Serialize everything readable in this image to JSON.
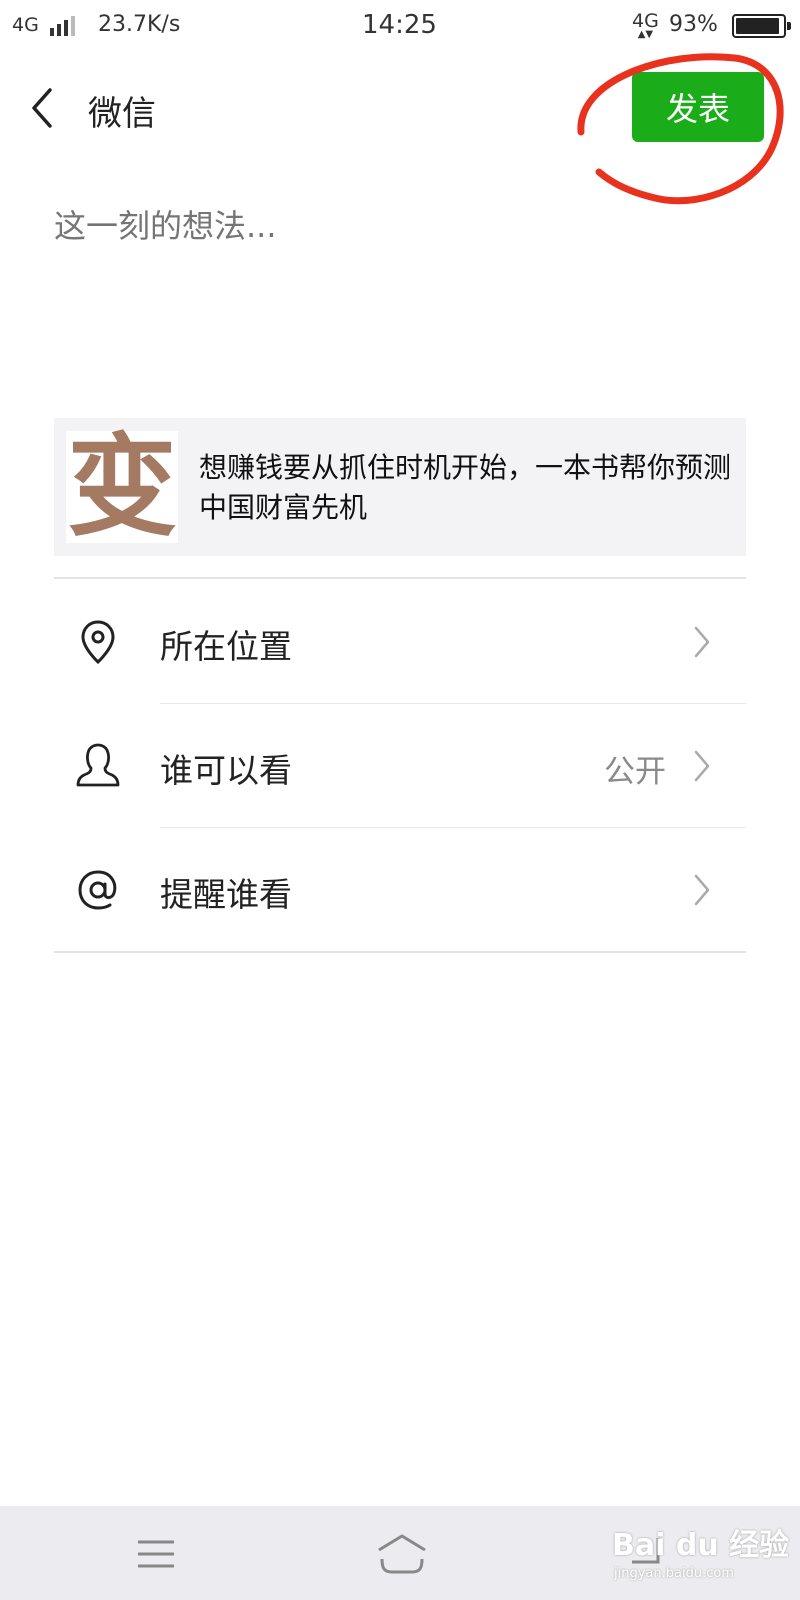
{
  "status_bar": {
    "network_left": "4G",
    "speed": "23.7K/s",
    "time": "14:25",
    "network_right": "4G",
    "battery_percent": "93%",
    "battery_level": 0.93
  },
  "header": {
    "title": "微信",
    "publish_label": "发表",
    "publish_color": "#1aad19",
    "annotation_color": "#e8321d"
  },
  "composer": {
    "placeholder": "这一刻的想法..."
  },
  "link_card": {
    "thumbnail_glyph": "变",
    "title": "想赚钱要从抓住时机开始，一本书帮你预测中国财富先机"
  },
  "options": [
    {
      "icon": "location-pin-icon",
      "label": "所在位置",
      "value": ""
    },
    {
      "icon": "user-icon",
      "label": "谁可以看",
      "value": "公开"
    },
    {
      "icon": "at-sign-icon",
      "label": "提醒谁看",
      "value": ""
    }
  ],
  "bottom_nav": {
    "icons": [
      "menu-icon",
      "home-icon",
      "back-icon"
    ],
    "watermark": "Bai du 经验",
    "watermark_sub": "jingyan.baidu.com"
  }
}
